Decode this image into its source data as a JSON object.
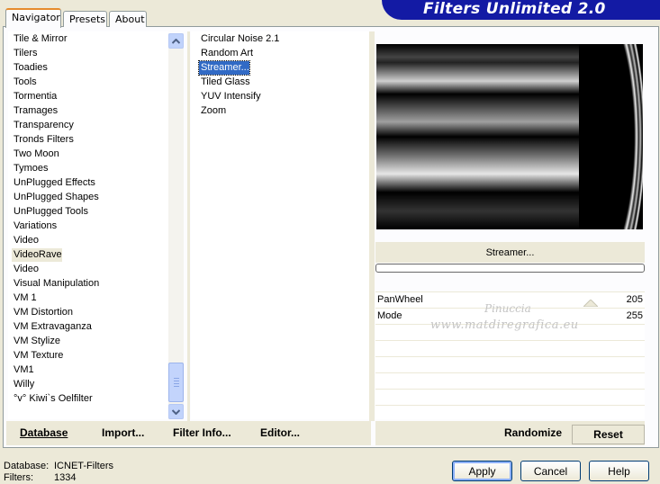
{
  "header": {
    "title": "Filters Unlimited 2.0"
  },
  "tabs": [
    {
      "label": "Navigator"
    },
    {
      "label": "Presets"
    },
    {
      "label": "About"
    }
  ],
  "categories": {
    "items": [
      "Tile & Mirror",
      "Tilers",
      "Toadies",
      "Tools",
      "Tormentia",
      "Tramages",
      "Transparency",
      "Tronds Filters",
      "Two Moon",
      "Tymoes",
      "UnPlugged Effects",
      "UnPlugged Shapes",
      "UnPlugged Tools",
      "Variations",
      "Video",
      "VideoRave",
      "Video",
      "Visual Manipulation",
      "VM 1",
      "VM Distortion",
      "VM Extravaganza",
      "VM Stylize",
      "VM Texture",
      "VM1",
      "Willy",
      "°v° Kiwi`s Oelfilter"
    ],
    "selected": "VideoRave"
  },
  "filters": {
    "items": [
      "Circular Noise 2.1",
      "Random Art",
      "Streamer...",
      "Tiled Glass",
      "YUV Intensify",
      "Zoom"
    ],
    "selected": "Streamer..."
  },
  "preview": {
    "filter_name": "Streamer..."
  },
  "params": [
    {
      "name": "PanWheel",
      "value": "205"
    },
    {
      "name": "Mode",
      "value": "255"
    }
  ],
  "watermark": {
    "line1": "Pinuccia",
    "line2": "www.matdiregrafica.eu"
  },
  "toolbar": {
    "database": "Database",
    "import": "Import...",
    "filter_info": "Filter Info...",
    "editor": "Editor...",
    "randomize": "Randomize",
    "reset": "Reset"
  },
  "status": {
    "database_label": "Database:",
    "database_value": "ICNET-Filters",
    "filters_label": "Filters:",
    "filters_value": "1334"
  },
  "buttons": {
    "apply": "Apply",
    "cancel": "Cancel",
    "help": "Help"
  }
}
